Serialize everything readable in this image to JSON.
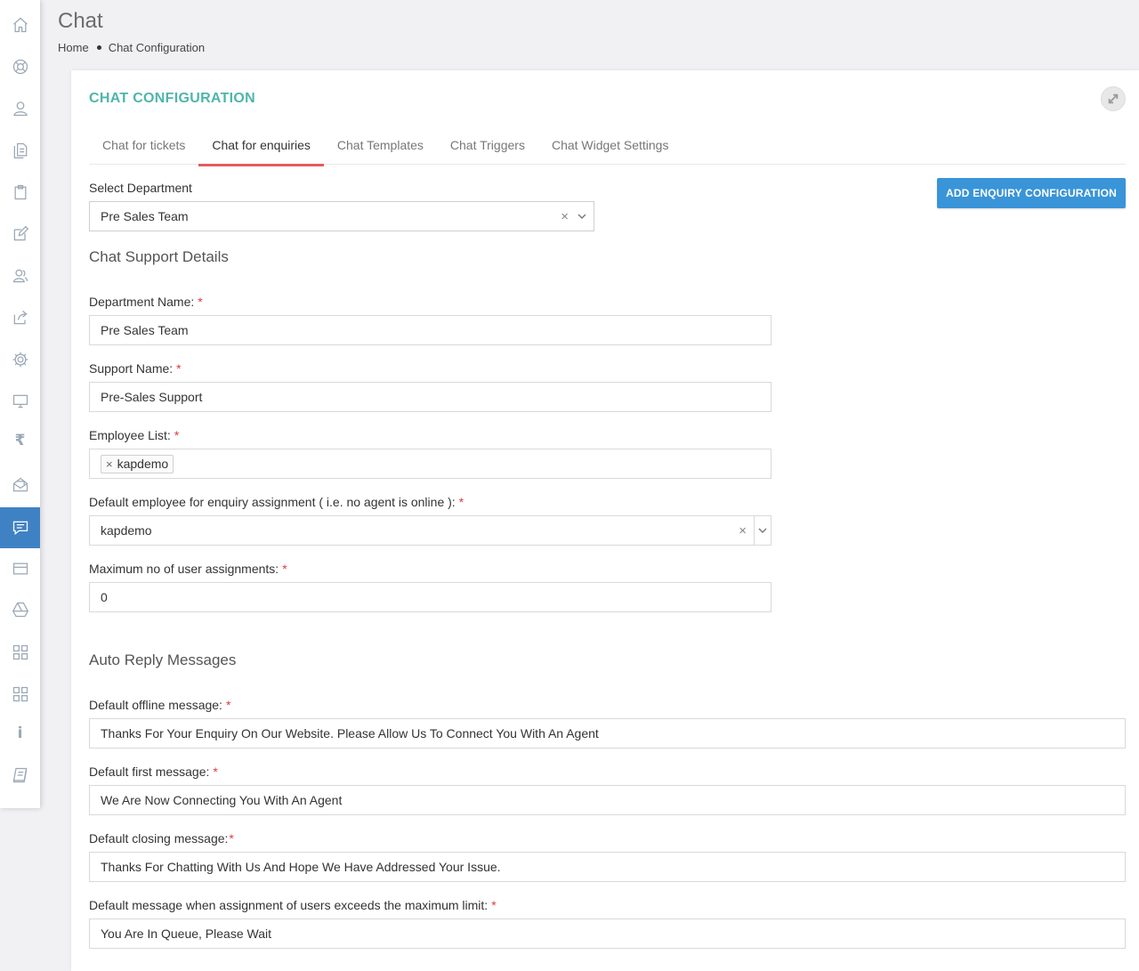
{
  "page": {
    "title": "Chat"
  },
  "breadcrumb": {
    "home": "Home",
    "current": "Chat Configuration"
  },
  "card": {
    "title": "CHAT CONFIGURATION"
  },
  "tabs": [
    {
      "label": "Chat for tickets",
      "active": false
    },
    {
      "label": "Chat for enquiries",
      "active": true
    },
    {
      "label": "Chat Templates",
      "active": false
    },
    {
      "label": "Chat Triggers",
      "active": false
    },
    {
      "label": "Chat Widget Settings",
      "active": false
    }
  ],
  "sidebar": {
    "icons": [
      "home-icon",
      "support-icon",
      "user-icon",
      "documents-icon",
      "clipboard-icon",
      "edit-icon",
      "contacts-icon",
      "share-icon",
      "settings-icon",
      "monitor-icon",
      "rupee-icon",
      "mail-open-icon",
      "chat-icon",
      "card-icon",
      "drive-icon",
      "grid-icon",
      "grid-alt-icon",
      "info-icon",
      "book-icon"
    ],
    "active": "chat-icon"
  },
  "department_select": {
    "label": "Select Department",
    "value": "Pre Sales Team"
  },
  "add_button": {
    "label": "ADD ENQUIRY CONFIGURATION"
  },
  "chat_support": {
    "title": "Chat Support Details",
    "department_name": {
      "label": "Department Name:",
      "value": "Pre Sales Team"
    },
    "support_name": {
      "label": "Support Name:",
      "value": "Pre-Sales Support"
    },
    "employee_list": {
      "label": "Employee List:",
      "tags": [
        "kapdemo"
      ]
    },
    "default_employee": {
      "label": "Default employee for enquiry assignment ( i.e. no agent is online ):",
      "value": "kapdemo"
    },
    "max_assignments": {
      "label": "Maximum no of user assignments:",
      "value": "0"
    }
  },
  "auto_reply": {
    "title": "Auto Reply Messages",
    "offline": {
      "label": "Default offline message:",
      "value": "Thanks For Your Enquiry On Our Website. Please Allow Us To Connect You With An Agent"
    },
    "first": {
      "label": "Default first message:",
      "value": "We Are Now Connecting You With An Agent"
    },
    "closing": {
      "label": "Default closing message:",
      "value": "Thanks For Chatting With Us And Hope We Have Addressed Your Issue."
    },
    "limit": {
      "label": "Default message when assignment of users exceeds the maximum limit:",
      "value": "You Are In Queue, Please Wait"
    }
  },
  "required_mark": "*",
  "colors": {
    "accent": "#4fb5ab",
    "primary": "#3a94d8",
    "active_tab": "#e35d5d",
    "sidebar_active": "#3f82c4"
  }
}
